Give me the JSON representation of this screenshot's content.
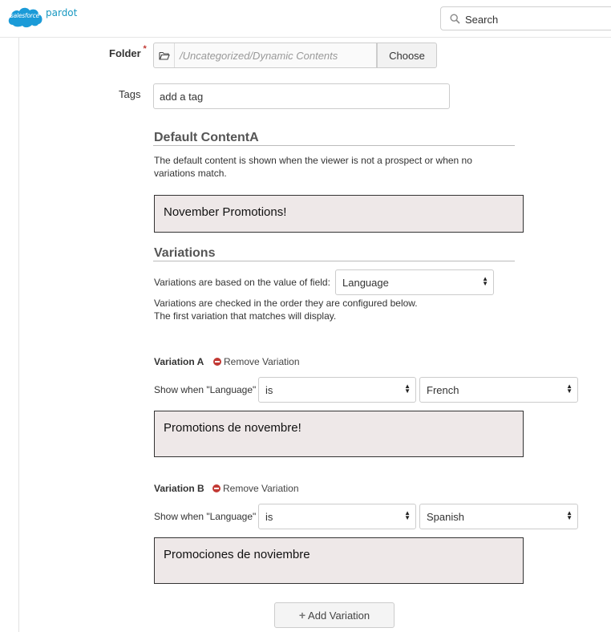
{
  "brand": {
    "logo_text": "salesforce",
    "product": "pardot"
  },
  "search": {
    "placeholder": "Search"
  },
  "folder": {
    "label": "Folder",
    "required_mark": "*",
    "path": "/Uncategorized/Dynamic Contents",
    "choose_label": "Choose"
  },
  "tags": {
    "label": "Tags",
    "value": "add a tag"
  },
  "default_content": {
    "title": "Default ContentA",
    "description_line1": "The default content is shown when the viewer is not a prospect or when no",
    "description_line2": "variations match.",
    "content": "November Promotions!"
  },
  "variations": {
    "title": "Variations",
    "based_on_label": "Variations are based on the value of field:",
    "field_value": "Language",
    "order_note_line1": "Variations are checked in the order they are configured below.",
    "order_note_line2": "The first variation that matches will display.",
    "remove_label": "Remove Variation",
    "items": [
      {
        "name": "Variation A",
        "show_when": "Show when \"Language\"",
        "operator": "is",
        "value": "French",
        "content": "Promotions de novembre!"
      },
      {
        "name": "Variation B",
        "show_when": "Show when \"Language\"",
        "operator": "is",
        "value": "Spanish",
        "content": "Promociones de noviembre"
      }
    ],
    "add_label": "Add Variation"
  },
  "colors": {
    "brand_blue": "#1798c1",
    "remove_red": "#c23934",
    "content_bg": "#eee8e8"
  },
  "icons": [
    "salesforce-cloud-logo",
    "search-icon",
    "folder-icon",
    "minus-circle-icon",
    "plus-icon",
    "select-arrows-icon"
  ]
}
